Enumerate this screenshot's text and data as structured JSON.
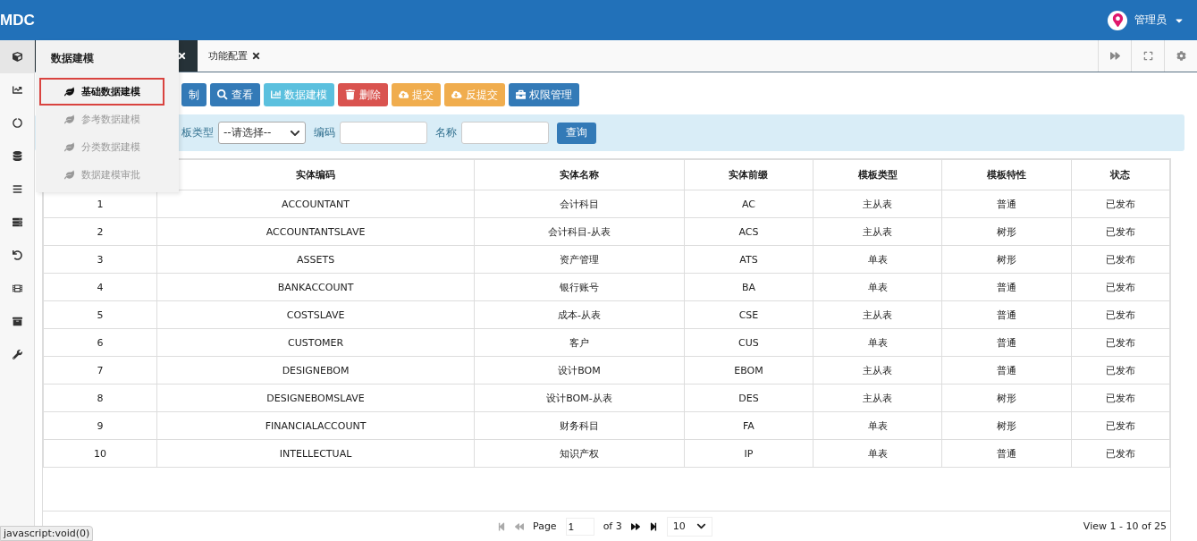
{
  "header": {
    "logo": "MDC",
    "user": "管理员"
  },
  "rail": [
    {
      "selected": true
    },
    {
      "selected": false
    },
    {
      "selected": false
    },
    {
      "selected": false
    },
    {
      "selected": false
    },
    {
      "selected": false
    },
    {
      "selected": false
    },
    {
      "selected": false
    },
    {
      "selected": false
    },
    {
      "selected": false
    }
  ],
  "flyout": {
    "title": "数据建模",
    "items": [
      {
        "label": "基础数据建模",
        "selected": true
      },
      {
        "label": "参考数据建模",
        "selected": false
      },
      {
        "label": "分类数据建模",
        "selected": false
      },
      {
        "label": "数据建模审批",
        "selected": false
      }
    ]
  },
  "tabs": [
    {
      "selected": true
    },
    {
      "label": "功能配置",
      "selected": false
    }
  ],
  "toolbar": [
    {
      "label": "制",
      "kind": "primary"
    },
    {
      "label": "查看",
      "kind": "primary"
    },
    {
      "label": "数据建模",
      "kind": "info"
    },
    {
      "label": "删除",
      "kind": "danger"
    },
    {
      "label": "提交",
      "kind": "warning"
    },
    {
      "label": "反提交",
      "kind": "warning"
    },
    {
      "label": "权限管理",
      "kind": "primary"
    }
  ],
  "filter": {
    "type_label": "板类型",
    "type_value": "--请选择--",
    "code_label": "编码",
    "name_label": "名称",
    "query": "查询"
  },
  "table": {
    "columns": [
      "",
      "实体编码",
      "实体名称",
      "实体前缀",
      "模板类型",
      "模板特性",
      "状态"
    ],
    "rows": [
      [
        "1",
        "ACCOUNTANT",
        "会计科目",
        "AC",
        "主从表",
        "普通",
        "已发布"
      ],
      [
        "2",
        "ACCOUNTANTSLAVE",
        "会计科目-从表",
        "ACS",
        "主从表",
        "树形",
        "已发布"
      ],
      [
        "3",
        "ASSETS",
        "资产管理",
        "ATS",
        "单表",
        "树形",
        "已发布"
      ],
      [
        "4",
        "BANKACCOUNT",
        "银行账号",
        "BA",
        "单表",
        "普通",
        "已发布"
      ],
      [
        "5",
        "COSTSLAVE",
        "成本-从表",
        "CSE",
        "主从表",
        "普通",
        "已发布"
      ],
      [
        "6",
        "CUSTOMER",
        "客户",
        "CUS",
        "单表",
        "普通",
        "已发布"
      ],
      [
        "7",
        "DESIGNEBOM",
        "设计BOM",
        "EBOM",
        "主从表",
        "普通",
        "已发布"
      ],
      [
        "8",
        "DESIGNEBOMSLAVE",
        "设计BOM-从表",
        "DES",
        "主从表",
        "树形",
        "已发布"
      ],
      [
        "9",
        "FINANCIALACCOUNT",
        "财务科目",
        "FA",
        "单表",
        "树形",
        "已发布"
      ],
      [
        "10",
        "INTELLECTUAL",
        "知识产权",
        "IP",
        "单表",
        "普通",
        "已发布"
      ]
    ]
  },
  "pager": {
    "page_label": "Page",
    "page": "1",
    "of": "of 3",
    "size": "10",
    "view": "View 1 - 10 of 25"
  },
  "status_bar": "javascript:void(0)"
}
